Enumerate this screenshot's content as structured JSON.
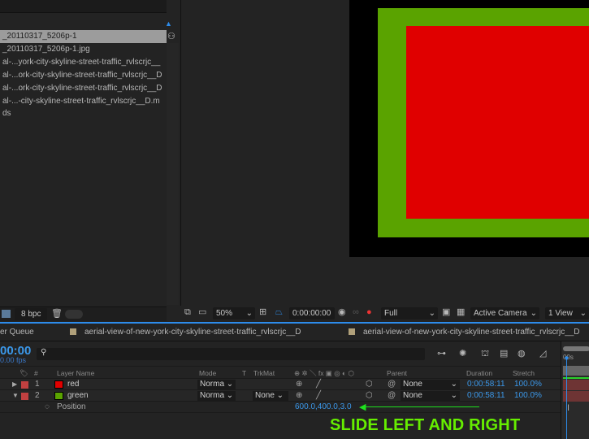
{
  "project": {
    "items": [
      "_20110317_5206p-1",
      "_20110317_5206p-1.jpg",
      "al-...york-city-skyline-street-traffic_rvlscrjc__",
      "al-...ork-city-skyline-street-traffic_rvlscrjc__D",
      "al-...ork-city-skyline-street-traffic_rvlscrjc__D",
      "al-...-city-skyline-street-traffic_rvlscrjc__D.m",
      "ds"
    ],
    "bpc": "8 bpc"
  },
  "viewer": {
    "zoom": "50%",
    "timecode": "0:00:00:00",
    "resolution": "Full",
    "camera": "Active Camera",
    "views": "1 View",
    "colors": {
      "background": "#000000",
      "green": "#5aa300",
      "red": "#e00000"
    }
  },
  "tabs": [
    "er Queue",
    "aerial-view-of-new-york-city-skyline-street-traffic_rvlscrjc__D",
    "aerial-view-of-new-york-city-skyline-street-traffic_rvlscrjc__D"
  ],
  "timeline": {
    "timecode": "00:00",
    "fps": "0.00 fps",
    "ruler": "00s",
    "headers": {
      "num": "#",
      "name": "Layer Name",
      "mode": "Mode",
      "t": "T",
      "trkmat": "TrkMat",
      "switches": "⊕ ✲ ＼ fx ▣ ◎ ◐ ⬡",
      "parent": "Parent",
      "duration": "Duration",
      "stretch": "Stretch"
    },
    "layers": [
      {
        "num": "1",
        "name": "red",
        "color": "#e00000",
        "mode": "Norma",
        "trkmat": "",
        "parent": "None",
        "duration": "0:00:58:11",
        "stretch": "100.0%",
        "expanded": false
      },
      {
        "num": "2",
        "name": "green",
        "color": "#5aa300",
        "mode": "Norma",
        "trkmat": "None",
        "parent": "None",
        "duration": "0:00:58:11",
        "stretch": "100.0%",
        "expanded": true
      }
    ],
    "property": {
      "name": "Position",
      "value": "600.0,400.0,3.0"
    }
  },
  "annotation": {
    "text": "SLIDE LEFT AND RIGHT",
    "color": "#66ee00"
  }
}
